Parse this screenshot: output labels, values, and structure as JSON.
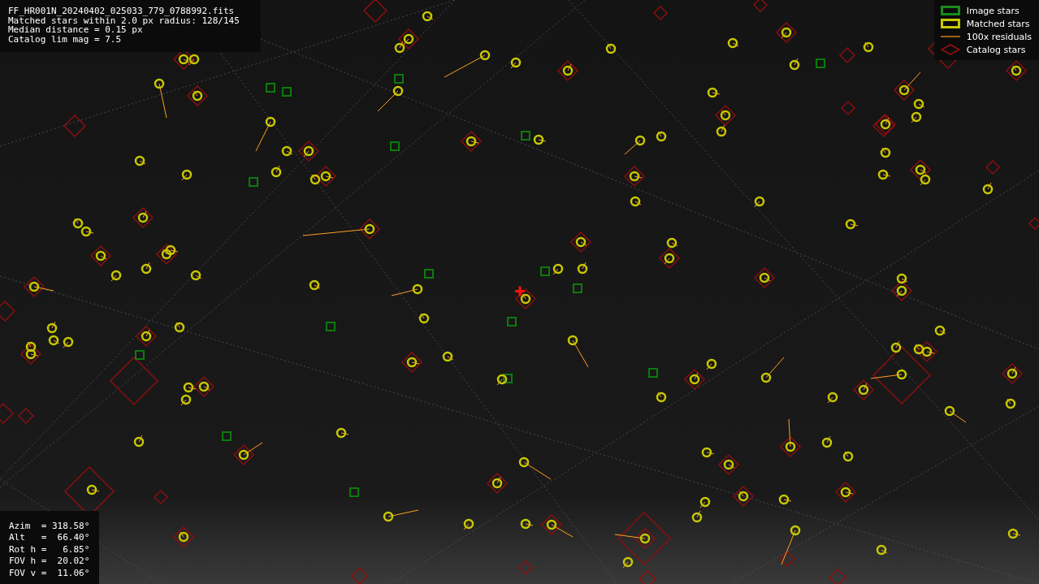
{
  "header": {
    "lines": [
      "FF_HR001N_20240402_025033_779_0788992.fits",
      "Matched stars within 2.0 px radius: 128/145",
      "Median distance = 0.15 px",
      "Catalog lim mag = 7.5"
    ]
  },
  "legend": [
    {
      "kind": "image",
      "label": "Image stars"
    },
    {
      "kind": "matched",
      "label": "Matched stars"
    },
    {
      "kind": "residual",
      "label": "100x residuals"
    },
    {
      "kind": "catalog",
      "label": "Catalog stars"
    }
  ],
  "pointing": [
    "Azim  = 318.58°",
    "Alt   =  66.40°",
    "Rot h =   6.85°",
    "FOV h =  20.02°",
    "FOV v =  11.06°"
  ]
}
